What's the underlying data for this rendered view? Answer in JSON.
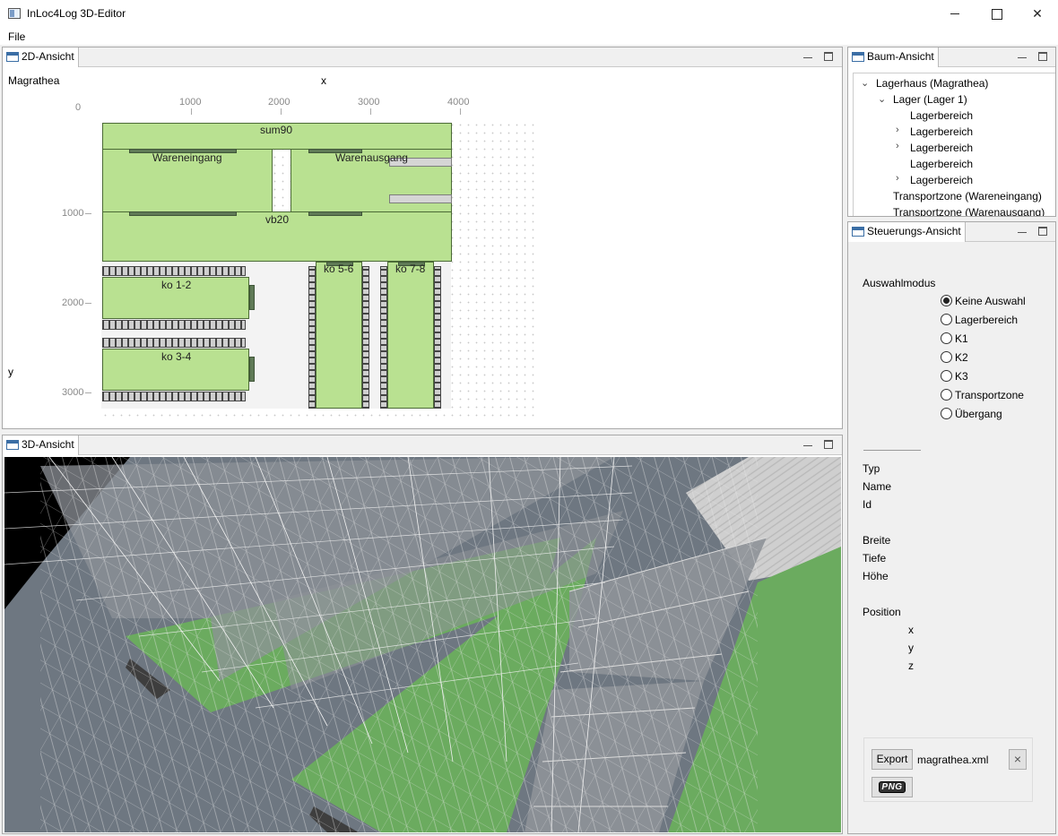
{
  "window": {
    "title": "InLoc4Log 3D-Editor",
    "minimize": "—",
    "maximize": "☐",
    "close": "✕"
  },
  "menu": {
    "file": "File"
  },
  "view2d": {
    "tab": "2D-Ansicht",
    "warehouse_name": "Magrathea",
    "axis_x": "x",
    "axis_y": "y",
    "x_ticks": [
      "1000",
      "2000",
      "3000",
      "4000"
    ],
    "y_ticks": [
      "0",
      "1000",
      "2000",
      "3000"
    ],
    "zones": {
      "sum90": "sum90",
      "wareneingang": "Wareneingang",
      "warenausgang": "Warenausgang",
      "vb20": "vb20",
      "ko12": "ko 1-2",
      "ko34": "ko 3-4",
      "ko56": "ko 5-6",
      "ko78": "ko 7-8"
    }
  },
  "view3d": {
    "tab": "3D-Ansicht"
  },
  "tree": {
    "tab": "Baum-Ansicht",
    "items": [
      {
        "label": "Lagerhaus (Magrathea)",
        "expander": "expanded"
      },
      {
        "label": "Lager (Lager 1)",
        "expander": "expanded"
      },
      {
        "label": "Lagerbereich",
        "expander": "none"
      },
      {
        "label": "Lagerbereich",
        "expander": "collapsed"
      },
      {
        "label": "Lagerbereich",
        "expander": "collapsed"
      },
      {
        "label": "Lagerbereich",
        "expander": "none"
      },
      {
        "label": "Lagerbereich",
        "expander": "collapsed"
      },
      {
        "label": "Transportzone (Wareneingang)",
        "expander": "none"
      },
      {
        "label": "Transportzone (Warenausgang)",
        "expander": "none"
      }
    ]
  },
  "control": {
    "tab": "Steuerungs-Ansicht",
    "mode_label": "Auswahlmodus",
    "modes": [
      {
        "label": "Keine Auswahl",
        "selected": true
      },
      {
        "label": "Lagerbereich",
        "selected": false
      },
      {
        "label": "K1",
        "selected": false
      },
      {
        "label": "K2",
        "selected": false
      },
      {
        "label": "K3",
        "selected": false
      },
      {
        "label": "Transportzone",
        "selected": false
      },
      {
        "label": "Übergang",
        "selected": false
      }
    ],
    "props": {
      "typ": "Typ",
      "name": "Name",
      "id": "Id",
      "breite": "Breite",
      "tiefe": "Tiefe",
      "hoehe": "Höhe",
      "position": "Position",
      "x": "x",
      "y": "y",
      "z": "z"
    },
    "export": {
      "button": "Export",
      "filename": "magrathea.xml",
      "clear": "×",
      "png": "PNG"
    }
  }
}
